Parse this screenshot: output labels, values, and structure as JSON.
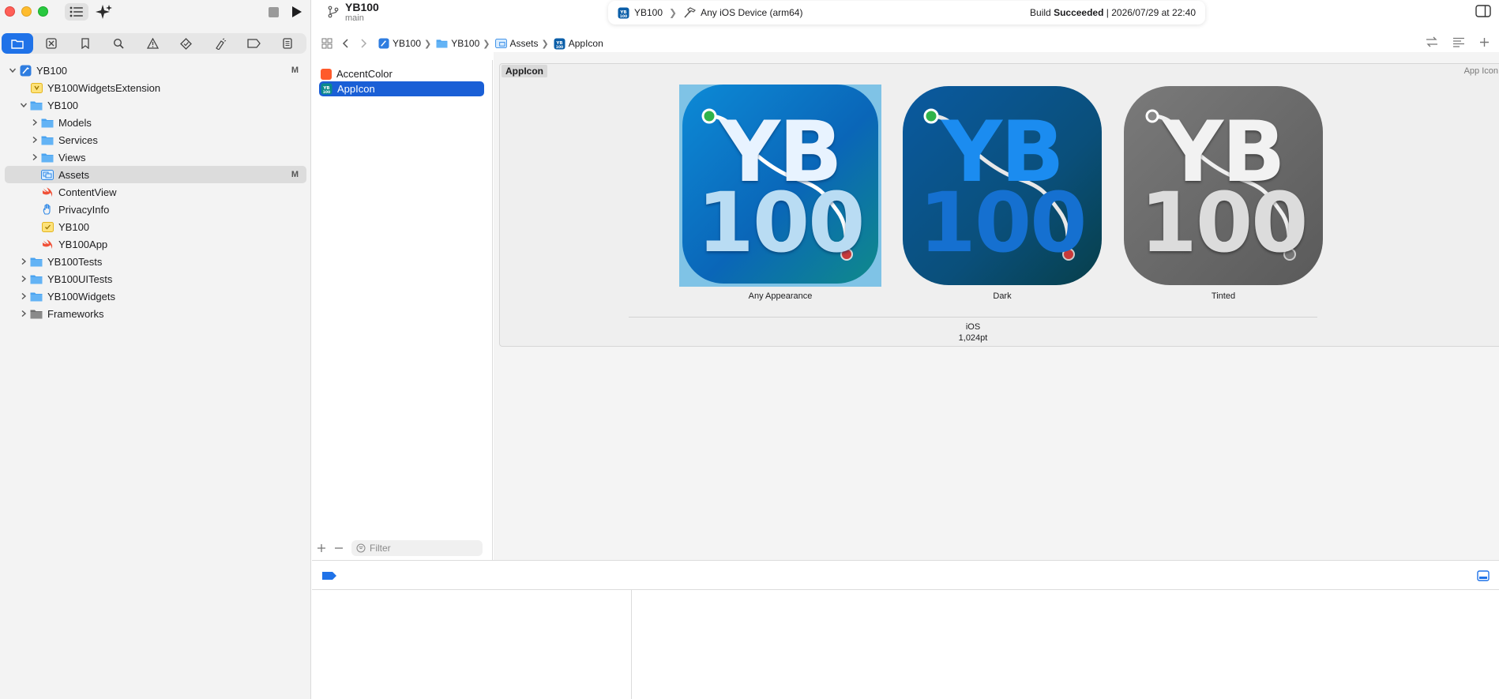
{
  "window": {
    "project_title": "YB100",
    "branch": "main"
  },
  "activity": {
    "scheme": "YB100",
    "destination": "Any iOS Device (arm64)",
    "status_prefix": "Build ",
    "status_bold": "Succeeded",
    "status_suffix": " | 2026/07/29 at 22:40"
  },
  "jumpbar": {
    "items": [
      "YB100",
      "YB100",
      "Assets",
      "AppIcon"
    ]
  },
  "navigator": {
    "tree": [
      {
        "label": "YB100",
        "badge": "M"
      },
      {
        "label": "YB100WidgetsExtension",
        "badge": ""
      },
      {
        "label": "YB100",
        "badge": ""
      },
      {
        "label": "Models",
        "badge": ""
      },
      {
        "label": "Services",
        "badge": ""
      },
      {
        "label": "Views",
        "badge": ""
      },
      {
        "label": "Assets",
        "badge": "M"
      },
      {
        "label": "ContentView",
        "badge": ""
      },
      {
        "label": "PrivacyInfo",
        "badge": ""
      },
      {
        "label": "YB100",
        "badge": ""
      },
      {
        "label": "YB100App",
        "badge": ""
      },
      {
        "label": "YB100Tests",
        "badge": ""
      },
      {
        "label": "YB100UITests",
        "badge": ""
      },
      {
        "label": "YB100Widgets",
        "badge": ""
      },
      {
        "label": "Frameworks",
        "badge": ""
      }
    ]
  },
  "assets": {
    "items": [
      "AccentColor",
      "AppIcon"
    ],
    "filter_placeholder": "Filter"
  },
  "editor": {
    "panel_label": "AppIcon",
    "panel_type": "App Icon",
    "icon_text_line1": "YB",
    "icon_text_line2": "100",
    "wells": [
      "Any Appearance",
      "Dark",
      "Tinted"
    ],
    "platform": "iOS",
    "size": "1,024pt"
  },
  "colors": {
    "accent": "#1f72e8",
    "selection": "#1a5fd6",
    "accent_color_swatch": "#ff5a2b",
    "folder": "#4aa3f0"
  }
}
